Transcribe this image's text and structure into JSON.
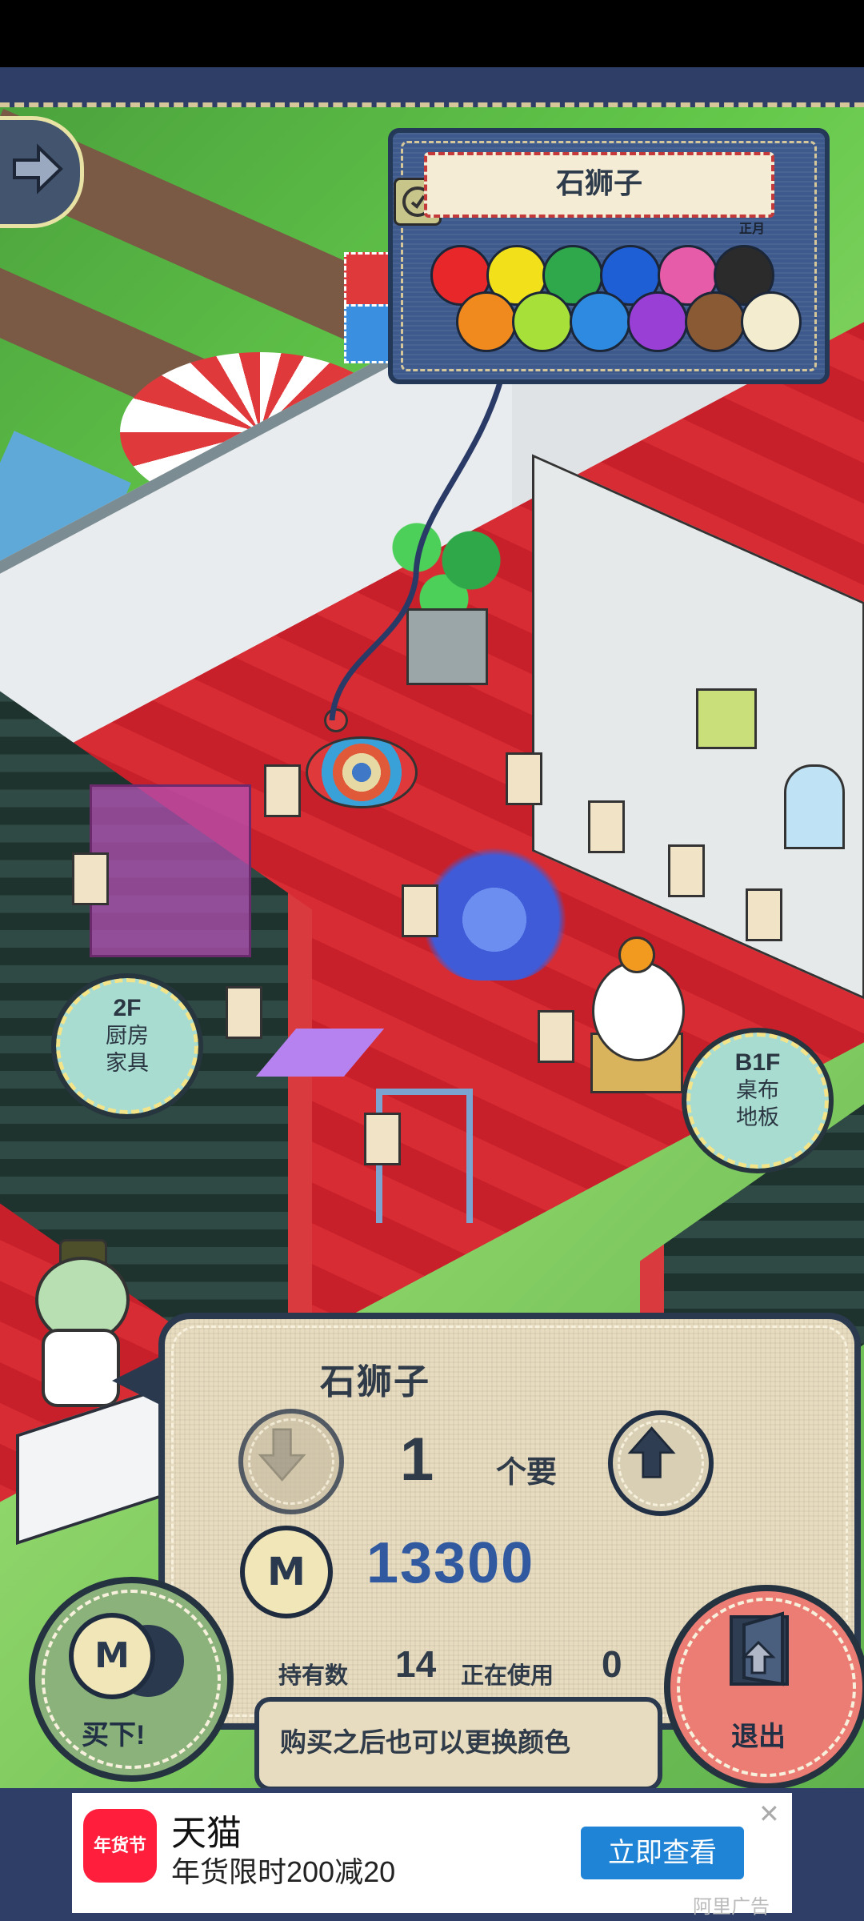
{
  "item": {
    "name": "石狮子",
    "facing": "正月"
  },
  "colors": {
    "swatches": [
      "#e8272a",
      "#f2e01b",
      "#2ea84a",
      "#1f5fd6",
      "#e65ca8",
      "#2b2b2b",
      "#f08a1e",
      "#a8e03a",
      "#2e8ae0",
      "#9a3fd6",
      "#8a5a34",
      "#f3eccf"
    ]
  },
  "floors": {
    "upper": {
      "level": "2F",
      "desc_line1": "厨房",
      "desc_line2": "家具"
    },
    "lower": {
      "level": "B1F",
      "desc_line1": "桌布",
      "desc_line2": "地板"
    }
  },
  "purchase": {
    "title": "石狮子",
    "quantity": "1",
    "unit": "个要",
    "price": "13300",
    "owned_label": "持有数",
    "owned_value": "14",
    "inuse_label": "正在使用",
    "inuse_value": "0",
    "hint": "购买之后也可以更换颜色",
    "buy_label": "买下!",
    "exit_label": "退出",
    "coin_symbol": "M"
  },
  "ad": {
    "logo_text": "年货节",
    "title": "天猫",
    "subtitle": "年货限时200减20",
    "cta": "立即查看",
    "close": "✕",
    "source": "阿里广告"
  }
}
